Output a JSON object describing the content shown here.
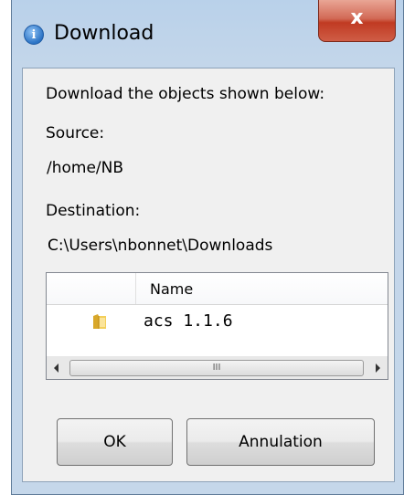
{
  "window": {
    "title": "Download",
    "close_label": "x"
  },
  "dialog": {
    "instruction": "Download the objects shown below:",
    "source_label": "Source:",
    "source_value": "/home/NB",
    "destination_label": "Destination:",
    "destination_value": "C:\\Users\\nbonnet\\Downloads"
  },
  "list": {
    "columns": [
      "",
      "Name"
    ],
    "rows": [
      {
        "icon": "folder-icon",
        "name": "acs 1.1.6"
      }
    ],
    "scroll_thumb_grip": "III"
  },
  "buttons": {
    "ok_label": "OK",
    "cancel_label": "Annulation"
  },
  "colors": {
    "frame": "#b9d1ea",
    "close_button": "#c03a22",
    "client_area": "#f0f0f0"
  }
}
